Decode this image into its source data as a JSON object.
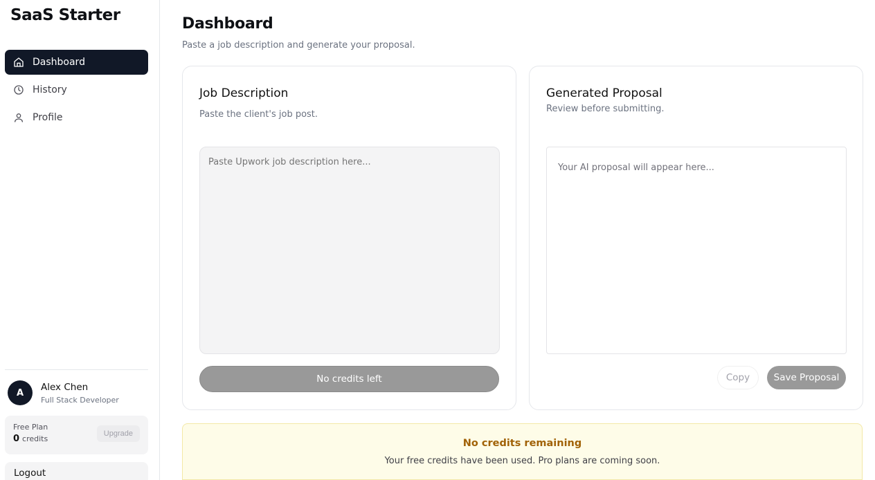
{
  "app": {
    "title": "SaaS Starter"
  },
  "sidebar": {
    "items": [
      {
        "label": "Dashboard",
        "icon": "home-icon",
        "active": true
      },
      {
        "label": "History",
        "icon": "clock-icon",
        "active": false
      },
      {
        "label": "Profile",
        "icon": "user-icon",
        "active": false
      }
    ],
    "user": {
      "initial": "A",
      "name": "Alex Chen",
      "role": "Full Stack Developer"
    },
    "plan": {
      "name": "Free Plan",
      "credits_count": "0",
      "credits_label": "credits",
      "upgrade_label": "Upgrade"
    },
    "logout_label": "Logout"
  },
  "main": {
    "title": "Dashboard",
    "subtitle": "Paste a job description and generate your proposal.",
    "job_card": {
      "title": "Job Description",
      "subtitle": "Paste the client's job post.",
      "placeholder": "Paste Upwork job description here...",
      "button_label": "No credits left"
    },
    "proposal_card": {
      "title": "Generated Proposal",
      "subtitle": "Review before submitting.",
      "placeholder": "Your AI proposal will appear here...",
      "copy_label": "Copy",
      "save_label": "Save Proposal"
    },
    "banner": {
      "title": "No credits remaining",
      "text": "Your free credits have been used. Pro plans are coming soon."
    }
  },
  "colors": {
    "nav_active_bg": "#111827",
    "banner_bg": "#fefce8",
    "banner_title": "#a16207",
    "disabled_button": "#999999"
  }
}
